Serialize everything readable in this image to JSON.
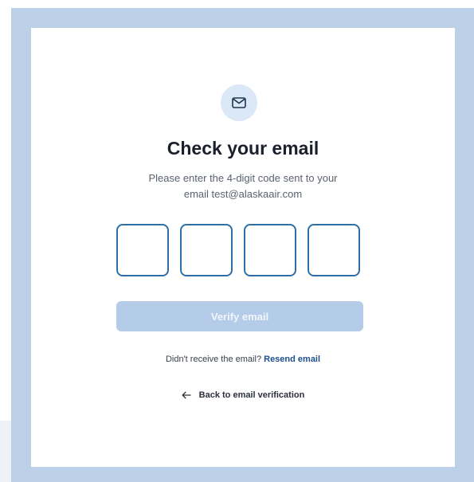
{
  "verification": {
    "icon": "mail-icon",
    "title": "Check your email",
    "instruction_line1": "Please enter the 4-digit code sent to your",
    "instruction_line2": "email test@alaskaair.com",
    "code_digits": [
      "",
      "",
      "",
      ""
    ],
    "verify_label": "Verify email",
    "resend_prompt": "Didn't receive the email?",
    "resend_label": "Resend email",
    "back_icon": "arrow-left-icon",
    "back_label": "Back to email verification"
  },
  "colors": {
    "backdrop": "#bcd0e8",
    "card": "#ffffff",
    "icon_bg": "#dbe8f7",
    "accent": "#2f6fa6",
    "button_disabled": "#b4cce8",
    "link": "#1e4f8a"
  }
}
